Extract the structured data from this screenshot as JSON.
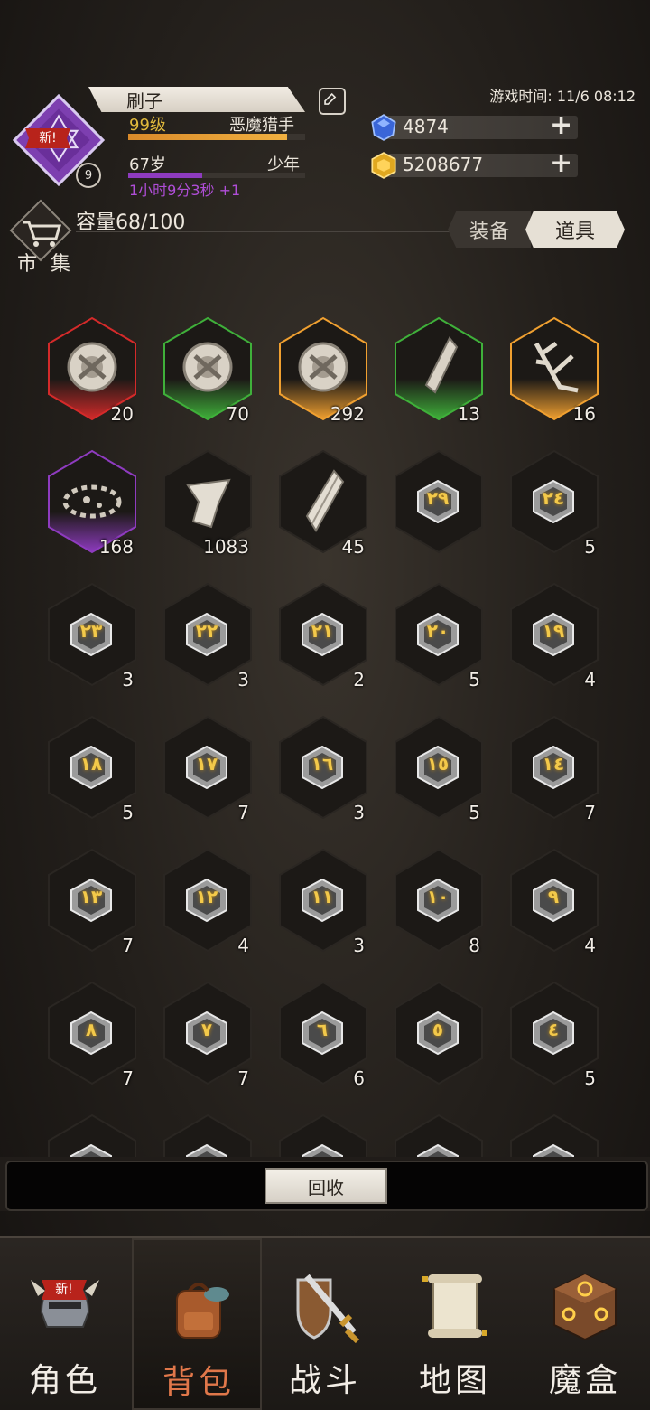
{
  "player": {
    "name": "刷子",
    "level": "99级",
    "title": "恶魔猎手",
    "age": "67岁",
    "stage": "少年",
    "timer": "1小时9分3秒 +1",
    "badge_number": "9",
    "new_tag": "新!",
    "level_progress": 0.9,
    "age_progress": 0.42
  },
  "game_time": "游戏时间: 11/6 08:12",
  "currencies": [
    {
      "name": "blue-gem-icon",
      "value": "4874"
    },
    {
      "name": "gold-coin-icon",
      "value": "5208677"
    }
  ],
  "market_label": "市 集",
  "capacity": "容量68/100",
  "tabs": {
    "equip": "装备",
    "items": "道具",
    "active": "items"
  },
  "colors": {
    "red": "#d42a2a",
    "green": "#3fb03a",
    "orange": "#f0a030",
    "purple": "#8e3bbf",
    "dark": "#1a1715"
  },
  "items": [
    {
      "type": "cog",
      "rarity": "red",
      "count": "20"
    },
    {
      "type": "cog",
      "rarity": "green",
      "count": "70"
    },
    {
      "type": "cog",
      "rarity": "orange",
      "count": "292"
    },
    {
      "type": "shard",
      "rarity": "green",
      "count": "13"
    },
    {
      "type": "branch",
      "rarity": "orange",
      "count": "16"
    },
    {
      "type": "dust",
      "rarity": "purple",
      "count": "168"
    },
    {
      "type": "fragment",
      "rarity": "dark",
      "count": "1083"
    },
    {
      "type": "crystal",
      "rarity": "dark",
      "count": "45"
    },
    {
      "type": "rune",
      "rarity": "dark",
      "glyph": "٢٩",
      "count": ""
    },
    {
      "type": "rune",
      "rarity": "dark",
      "glyph": "٢٤",
      "count": "5"
    },
    {
      "type": "rune",
      "rarity": "dark",
      "glyph": "٢٣",
      "count": "3"
    },
    {
      "type": "rune",
      "rarity": "dark",
      "glyph": "٢٢",
      "count": "3"
    },
    {
      "type": "rune",
      "rarity": "dark",
      "glyph": "٢١",
      "count": "2"
    },
    {
      "type": "rune",
      "rarity": "dark",
      "glyph": "٢٠",
      "count": "5"
    },
    {
      "type": "rune",
      "rarity": "dark",
      "glyph": "١٩",
      "count": "4"
    },
    {
      "type": "rune",
      "rarity": "dark",
      "glyph": "١٨",
      "count": "5"
    },
    {
      "type": "rune",
      "rarity": "dark",
      "glyph": "١٧",
      "count": "7"
    },
    {
      "type": "rune",
      "rarity": "dark",
      "glyph": "١٦",
      "count": "3"
    },
    {
      "type": "rune",
      "rarity": "dark",
      "glyph": "١٥",
      "count": "5"
    },
    {
      "type": "rune",
      "rarity": "dark",
      "glyph": "١٤",
      "count": "7"
    },
    {
      "type": "rune",
      "rarity": "dark",
      "glyph": "١٣",
      "count": "7"
    },
    {
      "type": "rune",
      "rarity": "dark",
      "glyph": "١٢",
      "count": "4"
    },
    {
      "type": "rune",
      "rarity": "dark",
      "glyph": "١١",
      "count": "3"
    },
    {
      "type": "rune",
      "rarity": "dark",
      "glyph": "١٠",
      "count": "8"
    },
    {
      "type": "rune",
      "rarity": "dark",
      "glyph": "٩",
      "count": "4"
    },
    {
      "type": "rune",
      "rarity": "dark",
      "glyph": "٨",
      "count": "7"
    },
    {
      "type": "rune",
      "rarity": "dark",
      "glyph": "٧",
      "count": "7"
    },
    {
      "type": "rune",
      "rarity": "dark",
      "glyph": "٦",
      "count": "6"
    },
    {
      "type": "rune",
      "rarity": "dark",
      "glyph": "٥",
      "count": ""
    },
    {
      "type": "rune",
      "rarity": "dark",
      "glyph": "٤",
      "count": "5"
    },
    {
      "type": "rune",
      "rarity": "dark",
      "glyph": "",
      "count": ""
    },
    {
      "type": "rune",
      "rarity": "dark",
      "glyph": "",
      "count": ""
    },
    {
      "type": "rune",
      "rarity": "dark",
      "glyph": "",
      "count": ""
    },
    {
      "type": "rune",
      "rarity": "dark",
      "glyph": "",
      "count": ""
    },
    {
      "type": "rune",
      "rarity": "dark",
      "glyph": "",
      "count": ""
    }
  ],
  "recycle_label": "回收",
  "nav": [
    {
      "label": "角色",
      "icon": "helmet-icon",
      "new": "新!"
    },
    {
      "label": "背包",
      "icon": "backpack-icon",
      "active": true
    },
    {
      "label": "战斗",
      "icon": "sword-shield-icon"
    },
    {
      "label": "地图",
      "icon": "scroll-map-icon"
    },
    {
      "label": "魔盒",
      "icon": "magic-box-icon"
    }
  ]
}
